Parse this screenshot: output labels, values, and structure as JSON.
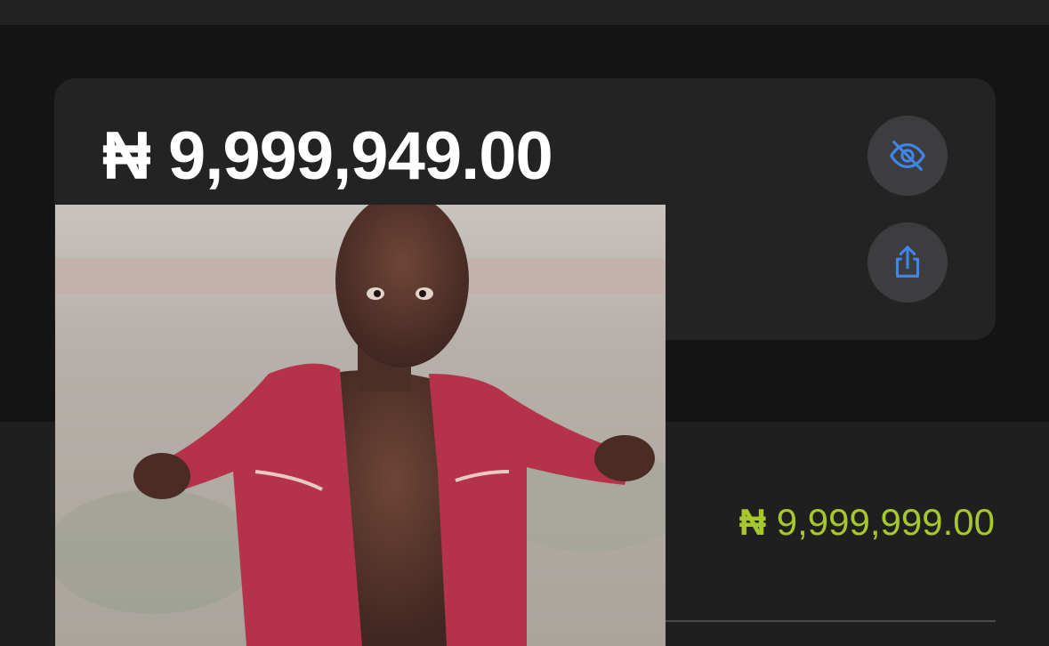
{
  "balance_card": {
    "balance": "₦ 9,999,949.00",
    "hide_button_icon": "eye-slash-icon",
    "share_button_icon": "share-icon"
  },
  "transaction": {
    "currency_symbol": "₦",
    "amount": "9,999,999.00"
  },
  "colors": {
    "background": "#141414",
    "card": "#232323",
    "button": "#3d3d3f",
    "icon_accent": "#3f86e8",
    "amount_green": "#a6c82a"
  }
}
